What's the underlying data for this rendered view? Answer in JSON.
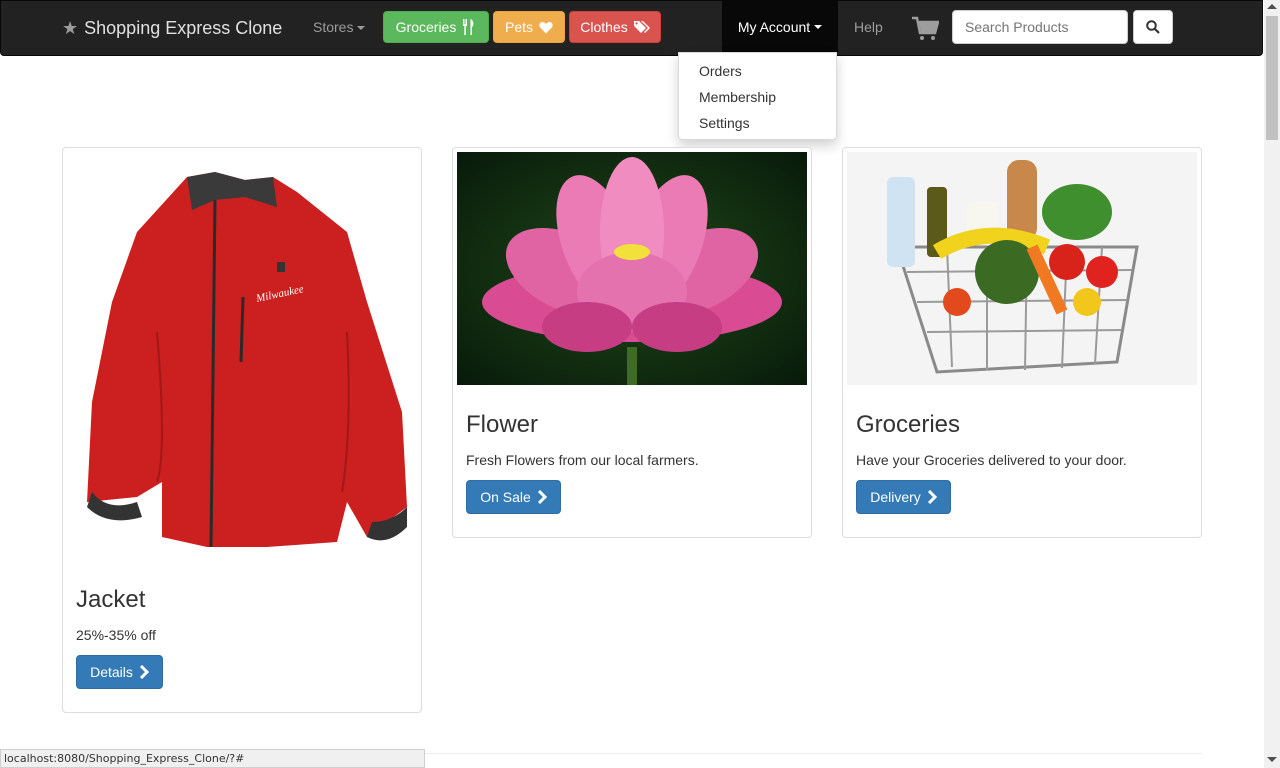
{
  "navbar": {
    "brand": "Shopping Express Clone",
    "stores_label": "Stores",
    "groceries_label": "Groceries",
    "pets_label": "Pets",
    "clothes_label": "Clothes",
    "account_label": "My Account",
    "help_label": "Help",
    "search_placeholder": "Search Products"
  },
  "account_menu": {
    "items": [
      "Orders",
      "Membership",
      "Settings"
    ]
  },
  "cards": [
    {
      "title": "Jacket",
      "text": "25%-35% off",
      "button": "Details"
    },
    {
      "title": "Flower",
      "text": "Fresh Flowers from our local farmers.",
      "button": "On Sale"
    },
    {
      "title": "Groceries",
      "text": "Have your Groceries delivered to your door.",
      "button": "Delivery"
    }
  ],
  "status_bar": {
    "url": "localhost:8080/Shopping_Express_Clone/?#"
  },
  "colors": {
    "navbar": "#222222",
    "success": "#5cb85c",
    "warning": "#f0ad4e",
    "danger": "#d9534f",
    "primary": "#337ab7"
  }
}
